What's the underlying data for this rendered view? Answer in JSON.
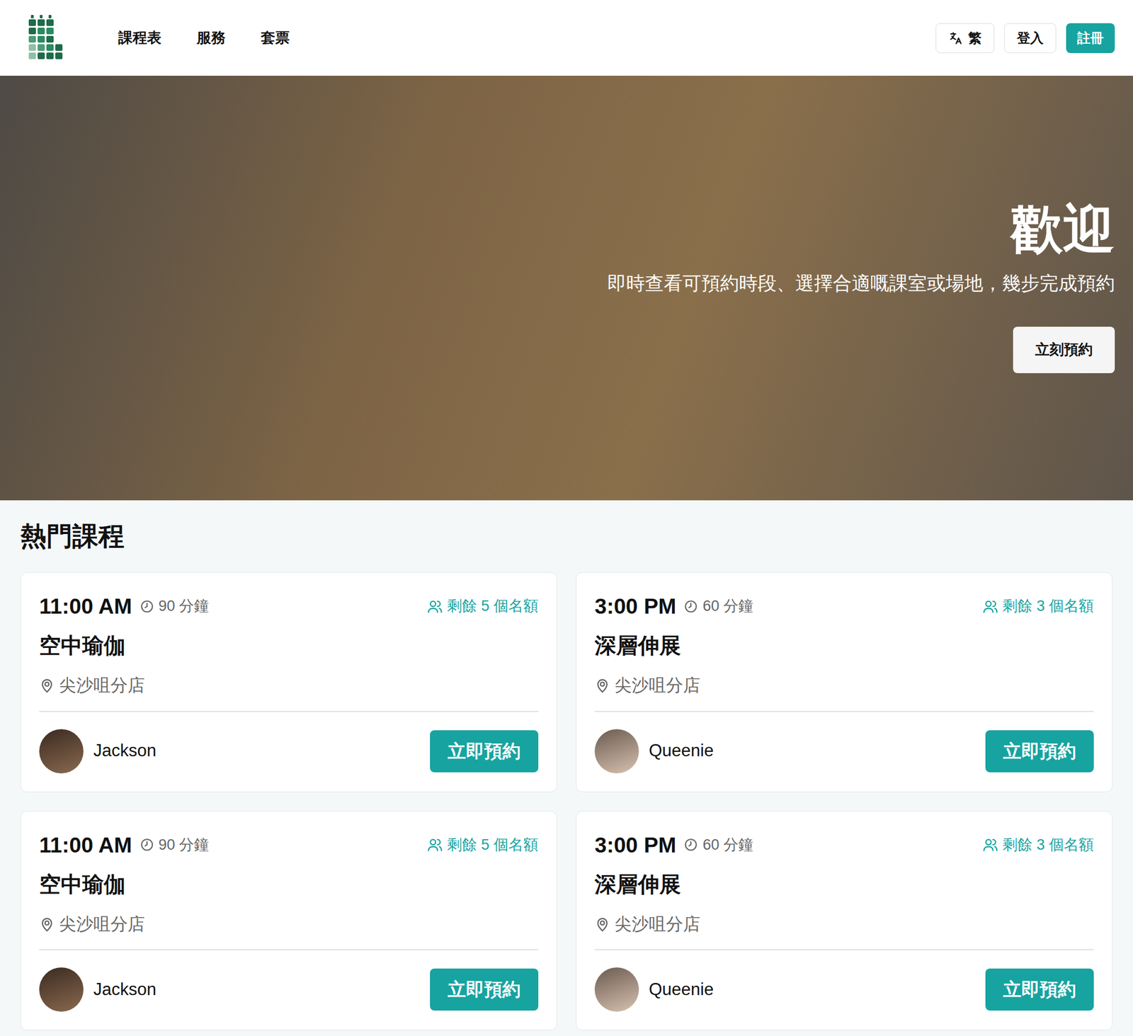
{
  "header": {
    "nav": [
      "課程表",
      "服務",
      "套票"
    ],
    "language": "繁",
    "login": "登入",
    "register": "註冊"
  },
  "hero": {
    "title": "歡迎",
    "subtitle": "即時查看可預約時段、選擇合適嘅課室或場地，幾步完成預約",
    "cta": "立刻預約"
  },
  "section": {
    "title": "熱門課程"
  },
  "classes": [
    {
      "time": "11:00 AM",
      "duration": "90 分鐘",
      "remaining": "剩餘 5 個名額",
      "name": "空中瑜伽",
      "location": "尖沙咀分店",
      "instructor": "Jackson",
      "book": "立即預約"
    },
    {
      "time": "3:00 PM",
      "duration": "60 分鐘",
      "remaining": "剩餘 3 個名額",
      "name": "深層伸展",
      "location": "尖沙咀分店",
      "instructor": "Queenie",
      "book": "立即預約"
    },
    {
      "time": "11:00 AM",
      "duration": "90 分鐘",
      "remaining": "剩餘 5 個名額",
      "name": "空中瑜伽",
      "location": "尖沙咀分店",
      "instructor": "Jackson",
      "book": "立即預約"
    },
    {
      "time": "3:00 PM",
      "duration": "60 分鐘",
      "remaining": "剩餘 3 個名額",
      "name": "深層伸展",
      "location": "尖沙咀分店",
      "instructor": "Queenie",
      "book": "立即預約"
    }
  ]
}
